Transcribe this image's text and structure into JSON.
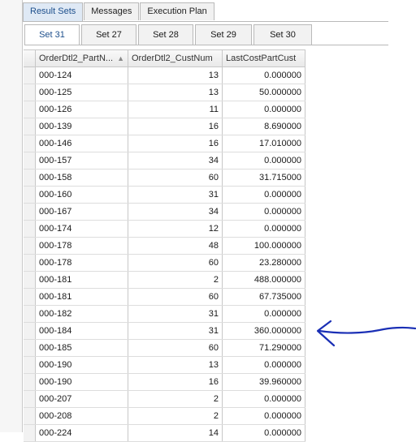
{
  "top_tabs": [
    "Result Sets",
    "Messages",
    "Execution Plan"
  ],
  "sub_tabs": [
    "Set 31",
    "Set 27",
    "Set 28",
    "Set 29",
    "Set 30"
  ],
  "columns": [
    "OrderDtl2_PartN...",
    "OrderDtl2_CustNum",
    "LastCostPartCust"
  ],
  "sort_indicator": "▲",
  "rows": [
    [
      "000-124",
      "13",
      "0.000000"
    ],
    [
      "000-125",
      "13",
      "50.000000"
    ],
    [
      "000-126",
      "11",
      "0.000000"
    ],
    [
      "000-139",
      "16",
      "8.690000"
    ],
    [
      "000-146",
      "16",
      "17.010000"
    ],
    [
      "000-157",
      "34",
      "0.000000"
    ],
    [
      "000-158",
      "60",
      "31.715000"
    ],
    [
      "000-160",
      "31",
      "0.000000"
    ],
    [
      "000-167",
      "34",
      "0.000000"
    ],
    [
      "000-174",
      "12",
      "0.000000"
    ],
    [
      "000-178",
      "48",
      "100.000000"
    ],
    [
      "000-178",
      "60",
      "23.280000"
    ],
    [
      "000-181",
      "2",
      "488.000000"
    ],
    [
      "000-181",
      "60",
      "67.735000"
    ],
    [
      "000-182",
      "31",
      "0.000000"
    ],
    [
      "000-184",
      "31",
      "360.000000"
    ],
    [
      "000-185",
      "60",
      "71.290000"
    ],
    [
      "000-190",
      "13",
      "0.000000"
    ],
    [
      "000-190",
      "16",
      "39.960000"
    ],
    [
      "000-207",
      "2",
      "0.000000"
    ],
    [
      "000-208",
      "2",
      "0.000000"
    ],
    [
      "000-224",
      "14",
      "0.000000"
    ]
  ],
  "annotation_color": "#1a2fb5"
}
